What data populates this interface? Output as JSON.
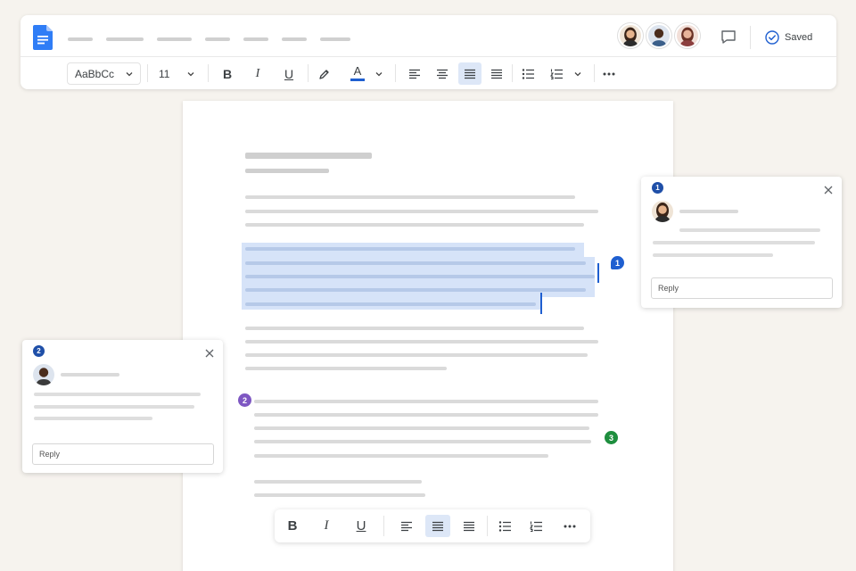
{
  "header": {
    "app_icon": "docs-icon",
    "menu_items": [
      "",
      "",
      "",
      "",
      "",
      "",
      ""
    ],
    "collaborators": [
      {
        "name": "collaborator-1",
        "icon": "avatar-woman",
        "color": "#caa07a"
      },
      {
        "name": "collaborator-2",
        "icon": "avatar-man",
        "color": "#5a3a28"
      },
      {
        "name": "collaborator-3",
        "icon": "avatar-woman",
        "color": "#b07060"
      }
    ],
    "comment_icon": "comment-icon",
    "saved_label": "Saved",
    "saved_icon": "check-circle-icon"
  },
  "toolbar": {
    "style_select": "AaBbCc",
    "font_size": "11",
    "bold_label": "B",
    "italic_label": "I",
    "underline_label": "U",
    "text_color_label": "A",
    "text_color": "#1f5fd0",
    "active_alignment": "justify"
  },
  "document": {
    "comment_markers": [
      {
        "number": "1",
        "color": "#1f5fd0"
      },
      {
        "number": "2",
        "color": "#7e57c2"
      },
      {
        "number": "3",
        "color": "#1e8e3e"
      }
    ]
  },
  "comments": [
    {
      "number": "1",
      "reply_placeholder": "Reply",
      "author_icon": "avatar-woman"
    },
    {
      "number": "2",
      "reply_placeholder": "Reply",
      "author_icon": "avatar-man"
    }
  ],
  "floating_toolbar": {
    "bold_label": "B",
    "italic_label": "I",
    "underline_label": "U",
    "active_alignment": "justify"
  },
  "colors": {
    "background": "#f6f3ee",
    "accent": "#1f5fd0",
    "selection": "#d6e3f8"
  }
}
